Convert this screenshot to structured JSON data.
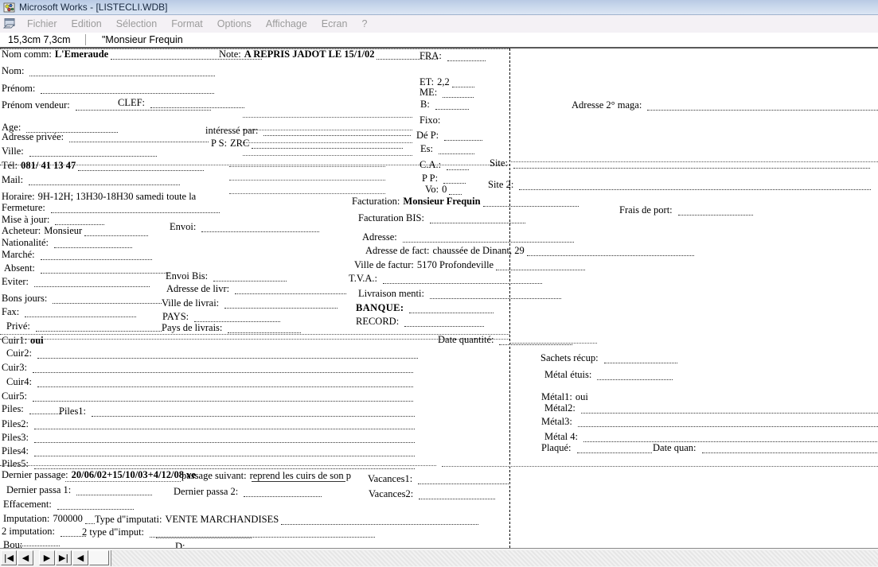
{
  "window": {
    "title": "Microsoft Works - [LISTECLI.WDB]",
    "app_icon": "works-database-icon"
  },
  "menu": {
    "icon": "works-document-icon",
    "items": [
      "Fichier",
      "Edition",
      "Sélection",
      "Format",
      "Options",
      "Affichage",
      "Ecran",
      "?"
    ]
  },
  "formula_bar": {
    "cell_reference": "15,3cm 7,3cm",
    "value": "\"Monsieur Frequin"
  },
  "form": {
    "col1": [
      {
        "label": "Nom comm:",
        "value": "L'Emeraude",
        "bold": true
      },
      {
        "label": "Nom:",
        "value": ""
      },
      {
        "label": "Prénom:",
        "value": ""
      },
      {
        "label": "Prénom vendeur:",
        "value": ""
      },
      {
        "label": "CLEF:",
        "value": ""
      },
      {
        "label": "Age:",
        "value": ""
      },
      {
        "label": "Adresse privée:",
        "value": ""
      },
      {
        "label": "Ville:",
        "value": ""
      },
      {
        "label": "Tél:",
        "value": "081/ 41 13 47",
        "bold": true
      },
      {
        "label": "Mail:",
        "value": ""
      },
      {
        "label": "Horaire:",
        "value": "9H-12H; 13H30-18H30 samedi toute la"
      },
      {
        "label": "Fermeture:",
        "value": ""
      },
      {
        "label": "Mise à jour:",
        "value": ""
      },
      {
        "label": "Acheteur:",
        "value": "Monsieur"
      },
      {
        "label": "Nationalité:",
        "value": ""
      },
      {
        "label": "Marché:",
        "value": ""
      },
      {
        "label": "Absent:",
        "value": ""
      },
      {
        "label": "Eviter:",
        "value": ""
      },
      {
        "label": "Bons jours:",
        "value": ""
      },
      {
        "label": "Fax:",
        "value": ""
      },
      {
        "label": "Privé:",
        "value": ""
      },
      {
        "label": "Cuir1:",
        "value": "oui",
        "bold": true
      },
      {
        "label": "Cuir2:",
        "value": ""
      },
      {
        "label": "Cuir3:",
        "value": ""
      },
      {
        "label": "Cuir4:",
        "value": ""
      },
      {
        "label": "Cuir5:",
        "value": ""
      },
      {
        "label": "Piles:",
        "value": ""
      },
      {
        "label": "Piles1:",
        "value": ""
      },
      {
        "label": "Piles2:",
        "value": ""
      },
      {
        "label": "Piles3:",
        "value": ""
      },
      {
        "label": "Piles4:",
        "value": ""
      },
      {
        "label": "Piles5:",
        "value": ""
      }
    ],
    "col2": [
      {
        "label": "Note:",
        "value": "A REPRIS JADOT LE 15/1/02",
        "bold": true
      },
      {
        "label": "intéressé par:",
        "value": ""
      },
      {
        "label": "P S:",
        "value": "ZRC"
      },
      {
        "label": "Envoi:",
        "value": ""
      },
      {
        "label": "Envoi Bis:",
        "value": ""
      },
      {
        "label": "Adresse de livr:",
        "value": ""
      },
      {
        "label": "Ville de livrai:",
        "value": ""
      },
      {
        "label": "PAYS:",
        "value": ""
      },
      {
        "label": "Pays de livrais:",
        "value": ""
      }
    ],
    "col3": [
      {
        "label": "FRA:",
        "value": ""
      },
      {
        "label": "ET:",
        "value": "2,2"
      },
      {
        "label": "ME:",
        "value": ""
      },
      {
        "label": "B:",
        "value": ""
      },
      {
        "label": "Fixo:",
        "value": ""
      },
      {
        "label": "Dé P:",
        "value": ""
      },
      {
        "label": "Es:",
        "value": ""
      },
      {
        "label": "C.A.:",
        "value": ""
      },
      {
        "label": "P P:",
        "value": ""
      },
      {
        "label": "Vo:",
        "value": "0"
      }
    ],
    "facturation": [
      {
        "label": "Facturation:",
        "value": "Monsieur Frequin",
        "bold": true
      },
      {
        "label": "Facturation BIS:",
        "value": ""
      },
      {
        "label": "Adresse:",
        "value": ""
      },
      {
        "label": "Adresse de fact:",
        "value": "chaussée de Dinant, 29"
      },
      {
        "label": "Ville de factur:",
        "value": "5170 Profondeville"
      },
      {
        "label": "T.V.A.:",
        "value": ""
      },
      {
        "label": "Livraison menti:",
        "value": ""
      },
      {
        "label": "BANQUE:",
        "value": "",
        "bold": true
      },
      {
        "label": "RECORD:",
        "value": ""
      },
      {
        "label": "Date quantité:",
        "value": ""
      }
    ],
    "right": [
      {
        "label": "Adresse 2° maga:",
        "value": ""
      },
      {
        "label": "Site:",
        "value": ""
      },
      {
        "label": "Site 2:",
        "value": ""
      },
      {
        "label": "Frais de port:",
        "value": ""
      },
      {
        "label": "Sachets récup:",
        "value": ""
      },
      {
        "label": "Métal étuis:",
        "value": ""
      },
      {
        "label": "Métal1:",
        "value": "oui"
      },
      {
        "label": "Métal2:",
        "value": ""
      },
      {
        "label": "Métal3:",
        "value": ""
      },
      {
        "label": "Métal 4:",
        "value": ""
      },
      {
        "label": "Plaqué:",
        "value": ""
      },
      {
        "label": "Date quan:",
        "value": ""
      }
    ],
    "bottom": [
      {
        "label": "Dernier passage:",
        "value": "20/06/02+15/10/03+4/12/08 ve",
        "bold": true
      },
      {
        "label": "passage suivant:",
        "value": "reprend les cuirs de son p"
      },
      {
        "label": "Dernier passa 1:",
        "value": ""
      },
      {
        "label": "Dernier passa 2:",
        "value": ""
      },
      {
        "label": "Effacement:",
        "value": ""
      },
      {
        "label": "Imputation:",
        "value": "700000"
      },
      {
        "label": "Type d\"imputati:",
        "value": "VENTE MARCHANDISES"
      },
      {
        "label": "2 imputation:",
        "value": ""
      },
      {
        "label": "2 type d\"imput:",
        "value": ""
      },
      {
        "label": "Bou:",
        "value": ""
      },
      {
        "label": "D:",
        "value": ""
      },
      {
        "label": "Vacances1:",
        "value": ""
      },
      {
        "label": "Vacances2:",
        "value": ""
      }
    ]
  },
  "navbar": {
    "buttons": [
      {
        "name": "first-record-button",
        "glyph": "|◀"
      },
      {
        "name": "previous-record-button",
        "glyph": "◀"
      },
      {
        "name": "next-record-button",
        "glyph": "▶"
      },
      {
        "name": "last-record-button",
        "glyph": "▶|"
      },
      {
        "name": "scroll-left-button",
        "glyph": "◀"
      }
    ]
  },
  "colors": {
    "titlebar": "#c9d8ec",
    "menubar": "#f4f1f5",
    "canvas": "#ffffff",
    "text": "#000000",
    "menu_text": "#9b9b9b"
  }
}
